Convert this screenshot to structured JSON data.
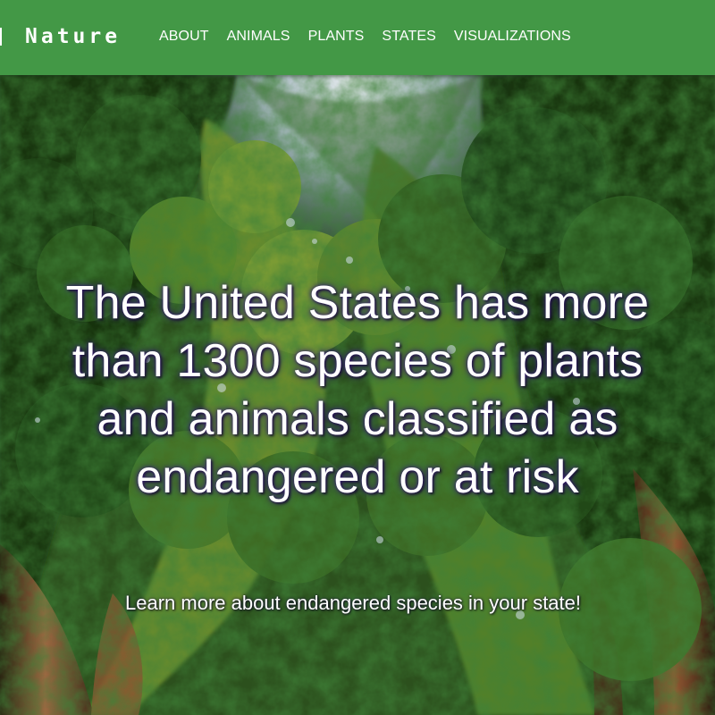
{
  "header": {
    "brand": "Nature",
    "nav": {
      "items": [
        {
          "label": "ABOUT"
        },
        {
          "label": "ANIMALS"
        },
        {
          "label": "PLANTS"
        },
        {
          "label": "STATES"
        },
        {
          "label": "VISUALIZATIONS"
        }
      ]
    }
  },
  "hero": {
    "headline": "The United States has more than 1300 species of plants and animals classified as endangered or at risk",
    "subtitle": "Learn more about endangered species in your state!"
  },
  "colors": {
    "nav_background": "#439846",
    "text": "#ffffff",
    "headline_glow": "#2d1469"
  },
  "icons": {
    "brand_rule": "vertical-line"
  }
}
